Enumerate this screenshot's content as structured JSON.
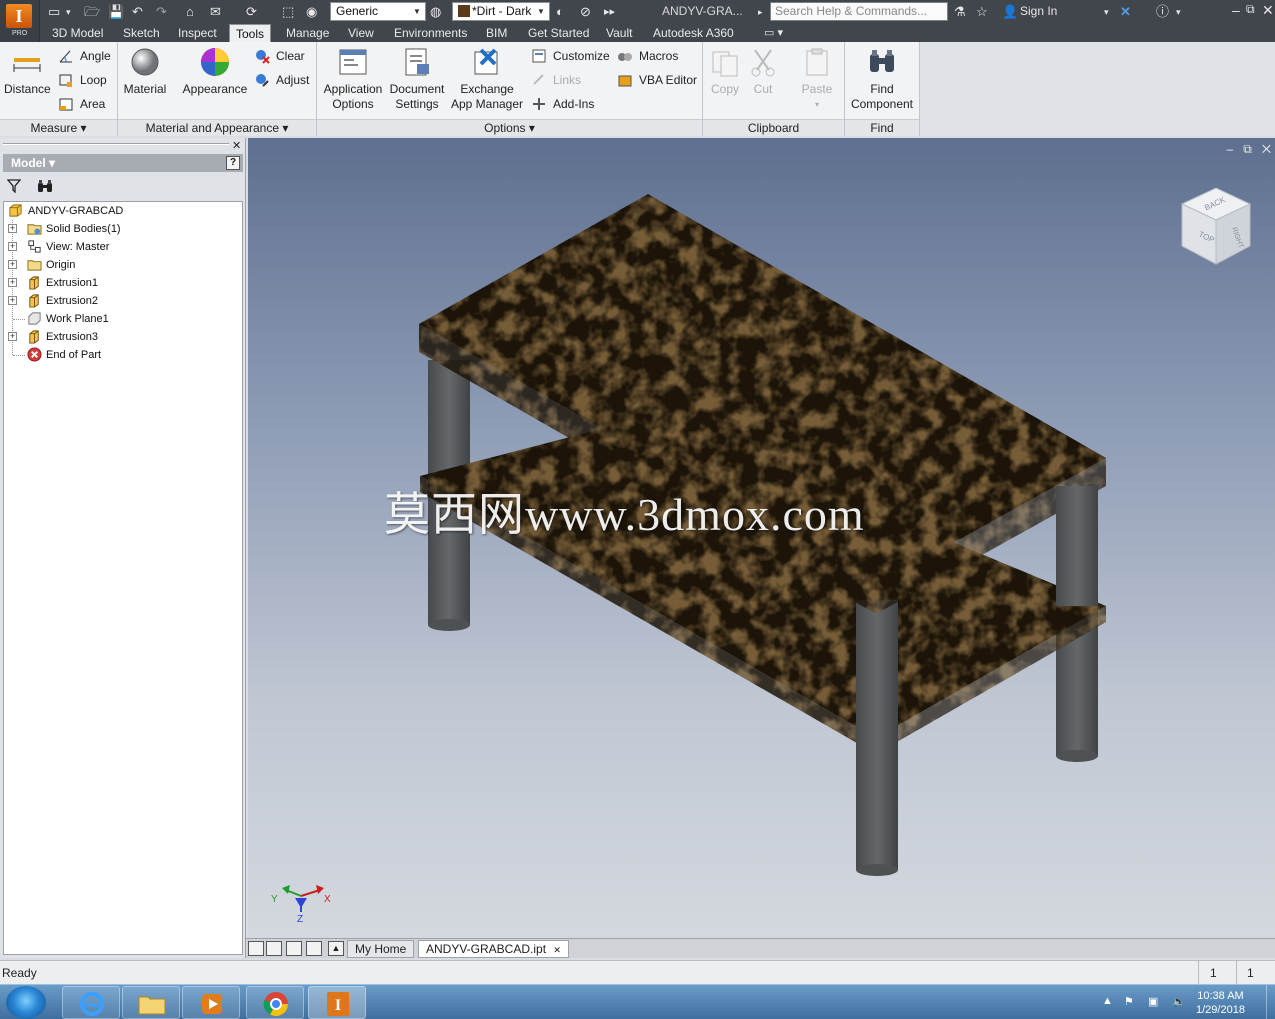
{
  "app": {
    "badge_letter": "I",
    "badge_sub": "PRO",
    "doc_title": "ANDYV-GRA...",
    "search_placeholder": "Search Help & Commands...",
    "sign_in": "Sign In",
    "material_dropdown": "Generic",
    "appearance_dropdown": "*Dirt - Dark"
  },
  "tabs": [
    "3D Model",
    "Sketch",
    "Inspect",
    "Tools",
    "Manage",
    "View",
    "Environments",
    "BIM",
    "Get Started",
    "Vault",
    "Autodesk A360"
  ],
  "active_tab": "Tools",
  "ribbon": {
    "measure": {
      "title": "Measure",
      "distance": "Distance",
      "angle": "Angle",
      "loop": "Loop",
      "area": "Area"
    },
    "material_appearance": {
      "title": "Material and Appearance",
      "material": "Material",
      "appearance": "Appearance",
      "clear": "Clear",
      "adjust": "Adjust"
    },
    "options": {
      "title": "Options",
      "app_options_1": "Application",
      "app_options_2": "Options",
      "doc_settings_1": "Document",
      "doc_settings_2": "Settings",
      "exchange_1": "Exchange",
      "exchange_2": "App Manager",
      "customize": "Customize",
      "links": "Links",
      "addins": "Add-Ins",
      "macros": "Macros",
      "vba": "VBA Editor"
    },
    "clipboard": {
      "title": "Clipboard",
      "copy": "Copy",
      "cut": "Cut",
      "paste": "Paste"
    },
    "find": {
      "title": "Find",
      "find_1": "Find",
      "find_2": "Component"
    }
  },
  "browser": {
    "title": "Model",
    "help": "?",
    "tree": [
      {
        "label": "ANDYV-GRABCAD",
        "icon": "part-icon"
      },
      {
        "label": "Solid Bodies(1)",
        "icon": "solid-bodies-icon"
      },
      {
        "label": "View: Master",
        "icon": "view-icon"
      },
      {
        "label": "Origin",
        "icon": "folder-icon"
      },
      {
        "label": "Extrusion1",
        "icon": "extrusion-icon"
      },
      {
        "label": "Extrusion2",
        "icon": "extrusion-icon"
      },
      {
        "label": "Work Plane1",
        "icon": "work-plane-icon"
      },
      {
        "label": "Extrusion3",
        "icon": "extrusion-icon"
      },
      {
        "label": "End of Part",
        "icon": "end-of-part-icon"
      }
    ]
  },
  "viewport": {
    "watermark": "莫西网www.3dmox.com",
    "viewcube_top": "TOP",
    "viewcube_back": "BACK",
    "viewcube_right": "RIGHT",
    "axis_x": "X",
    "axis_y": "Y",
    "axis_z": "Z"
  },
  "doc_tabs": {
    "home": "My Home",
    "document": "ANDYV-GRABCAD.ipt"
  },
  "status": {
    "text": "Ready",
    "num1": "1",
    "num2": "1"
  },
  "taskbar": {
    "time": "10:38 AM",
    "date": "1/29/2018"
  },
  "colors": {
    "title_bar": "#41464d",
    "ribbon_bg": "#f2f3f4",
    "table_texture_dark": "#1f1609",
    "table_texture_light": "#8a5a2a",
    "leg_color": "#5a5d5f",
    "viewport_top": "#5e6f8f",
    "viewport_bottom": "#d4d8de"
  }
}
